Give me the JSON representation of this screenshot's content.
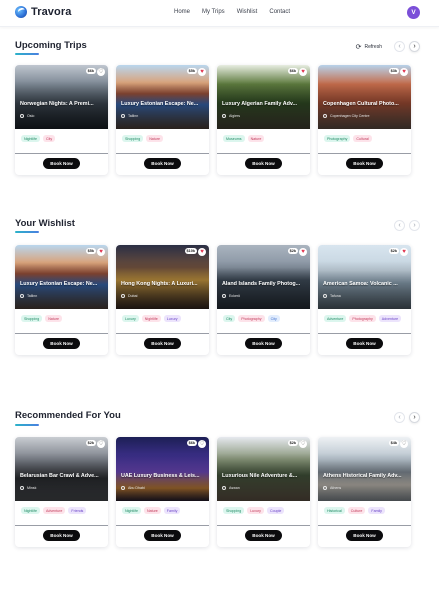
{
  "app": {
    "brand": "Travora",
    "nav": [
      "Home",
      "My Trips",
      "Wishlist",
      "Contact"
    ],
    "avatar_initial": "V"
  },
  "sections": [
    {
      "title": "Upcoming Trips",
      "refresh_label": "Refresh",
      "cards": [
        {
          "title": "Norwegian Nights: A Premi...",
          "location": "Oslo",
          "price": "$6k",
          "heart": "outline",
          "tags": [
            {
              "label": "Nightlife",
              "color": "green"
            },
            {
              "label": "City",
              "color": "pink"
            }
          ],
          "button": "Book Now",
          "scene": "night-street"
        },
        {
          "title": "Luxury Estonian Escape: Ne...",
          "location": "Tallinn",
          "price": "$5k",
          "heart": "filled",
          "tags": [
            {
              "label": "Shopping",
              "color": "green"
            },
            {
              "label": "Nature",
              "color": "pink"
            }
          ],
          "button": "Book Now",
          "scene": "old-town"
        },
        {
          "title": "Luxury Algerian Family Adv...",
          "location": "Algiers",
          "price": "$6k",
          "heart": "filled",
          "tags": [
            {
              "label": "Museums",
              "color": "green"
            },
            {
              "label": "Nature",
              "color": "pink"
            }
          ],
          "button": "Book Now",
          "scene": "forest"
        },
        {
          "title": "Copenhagen Cultural Photo...",
          "location": "Copenhagen City Centre",
          "price": "$3k",
          "heart": "filled",
          "tags": [
            {
              "label": "Photography",
              "color": "green"
            },
            {
              "label": "Cultural",
              "color": "pink"
            }
          ],
          "button": "Book Now",
          "scene": "brick-building"
        }
      ]
    },
    {
      "title": "Your Wishlist",
      "cards": [
        {
          "title": "Luxury Estonian Escape: Ne...",
          "location": "Tallinn",
          "price": "$5k",
          "heart": "filled",
          "tags": [
            {
              "label": "Shopping",
              "color": "green"
            },
            {
              "label": "Nature",
              "color": "pink"
            }
          ],
          "button": "Book Now",
          "scene": "old-town"
        },
        {
          "title": "Hong Kong Nights: A Luxuri...",
          "location": "Dubai",
          "price": "$10k",
          "heart": "filled",
          "tags": [
            {
              "label": "Luxury",
              "color": "green"
            },
            {
              "label": "Nightlife",
              "color": "pink"
            },
            {
              "label": "Luxury",
              "color": "purple"
            }
          ],
          "button": "Book Now",
          "scene": "neon-city"
        },
        {
          "title": "Åland Islands Family Photog...",
          "location": "Eckerö",
          "price": "$2k",
          "heart": "filled",
          "tags": [
            {
              "label": "City",
              "color": "green"
            },
            {
              "label": "Photography",
              "color": "pink"
            },
            {
              "label": "City",
              "color": "blue"
            }
          ],
          "button": "Book Now",
          "scene": "sea"
        },
        {
          "title": "American Samoa: Volcanic ...",
          "location": "Tafuna",
          "price": "$2k",
          "heart": "filled",
          "tags": [
            {
              "label": "Adventure",
              "color": "green"
            },
            {
              "label": "Photography",
              "color": "pink"
            },
            {
              "label": "Adventure",
              "color": "purple"
            }
          ],
          "button": "Book Now",
          "scene": "harbor"
        }
      ]
    },
    {
      "title": "Recommended For You",
      "cards": [
        {
          "title": "Belarusian Bar Crawl & Adve...",
          "location": "Minsk",
          "price": "$2k",
          "heart": "outline",
          "tags": [
            {
              "label": "Nightlife",
              "color": "green"
            },
            {
              "label": "Adventure",
              "color": "pink"
            },
            {
              "label": "Friends",
              "color": "purple"
            }
          ],
          "button": "Book Now",
          "scene": "car"
        },
        {
          "title": "UAE Luxury Business & Leis...",
          "location": "Abu Dhabi",
          "price": "$6k",
          "heart": "outline",
          "tags": [
            {
              "label": "Nightlife",
              "color": "green"
            },
            {
              "label": "Nature",
              "color": "pink"
            },
            {
              "label": "Family",
              "color": "purple"
            }
          ],
          "button": "Book Now",
          "scene": "skyline"
        },
        {
          "title": "Luxurious Nile Adventure &...",
          "location": "Aswan",
          "price": "$2k",
          "heart": "outline",
          "tags": [
            {
              "label": "Shopping",
              "color": "green"
            },
            {
              "label": "Luxury",
              "color": "pink"
            },
            {
              "label": "Couple",
              "color": "purple"
            }
          ],
          "button": "Book Now",
          "scene": "palms"
        },
        {
          "title": "Athens Historical Family Adv...",
          "location": "Athens",
          "price": "$4k",
          "heart": "outline",
          "tags": [
            {
              "label": "Historical",
              "color": "green"
            },
            {
              "label": "Culture",
              "color": "pink"
            },
            {
              "label": "Family",
              "color": "purple"
            }
          ],
          "button": "Book Now",
          "scene": "festival"
        }
      ]
    }
  ]
}
